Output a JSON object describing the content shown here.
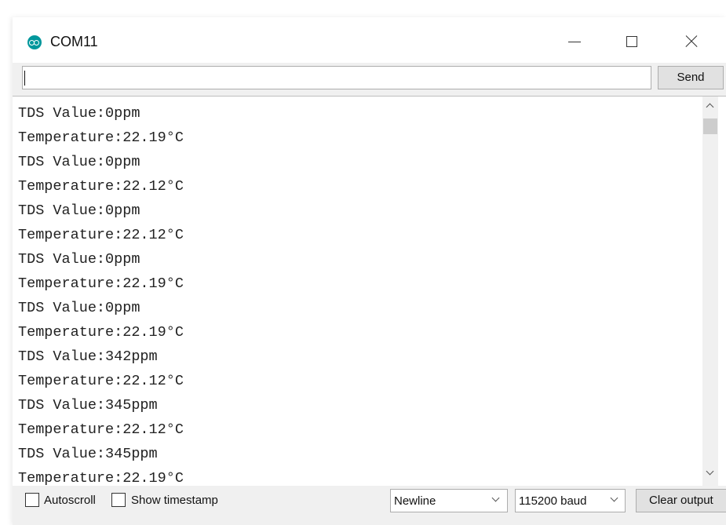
{
  "window": {
    "title": "COM11",
    "icon": "arduino-logo-icon",
    "accent_color": "#00979c"
  },
  "input": {
    "value": ""
  },
  "toolbar": {
    "send_label": "Send"
  },
  "output": {
    "lines": [
      "TDS Value:0ppm",
      "Temperature:22.19°C",
      "TDS Value:0ppm",
      "Temperature:22.12°C",
      "TDS Value:0ppm",
      "Temperature:22.12°C",
      "TDS Value:0ppm",
      "Temperature:22.19°C",
      "TDS Value:0ppm",
      "Temperature:22.19°C",
      "TDS Value:342ppm",
      "Temperature:22.12°C",
      "TDS Value:345ppm",
      "Temperature:22.12°C",
      "TDS Value:345ppm",
      "Temperature:22.19°C"
    ]
  },
  "bottom": {
    "autoscroll_label": "Autoscroll",
    "autoscroll_checked": false,
    "timestamp_label": "Show timestamp",
    "timestamp_checked": false,
    "line_ending": "Newline",
    "baud_rate": "115200 baud",
    "clear_label": "Clear output"
  }
}
